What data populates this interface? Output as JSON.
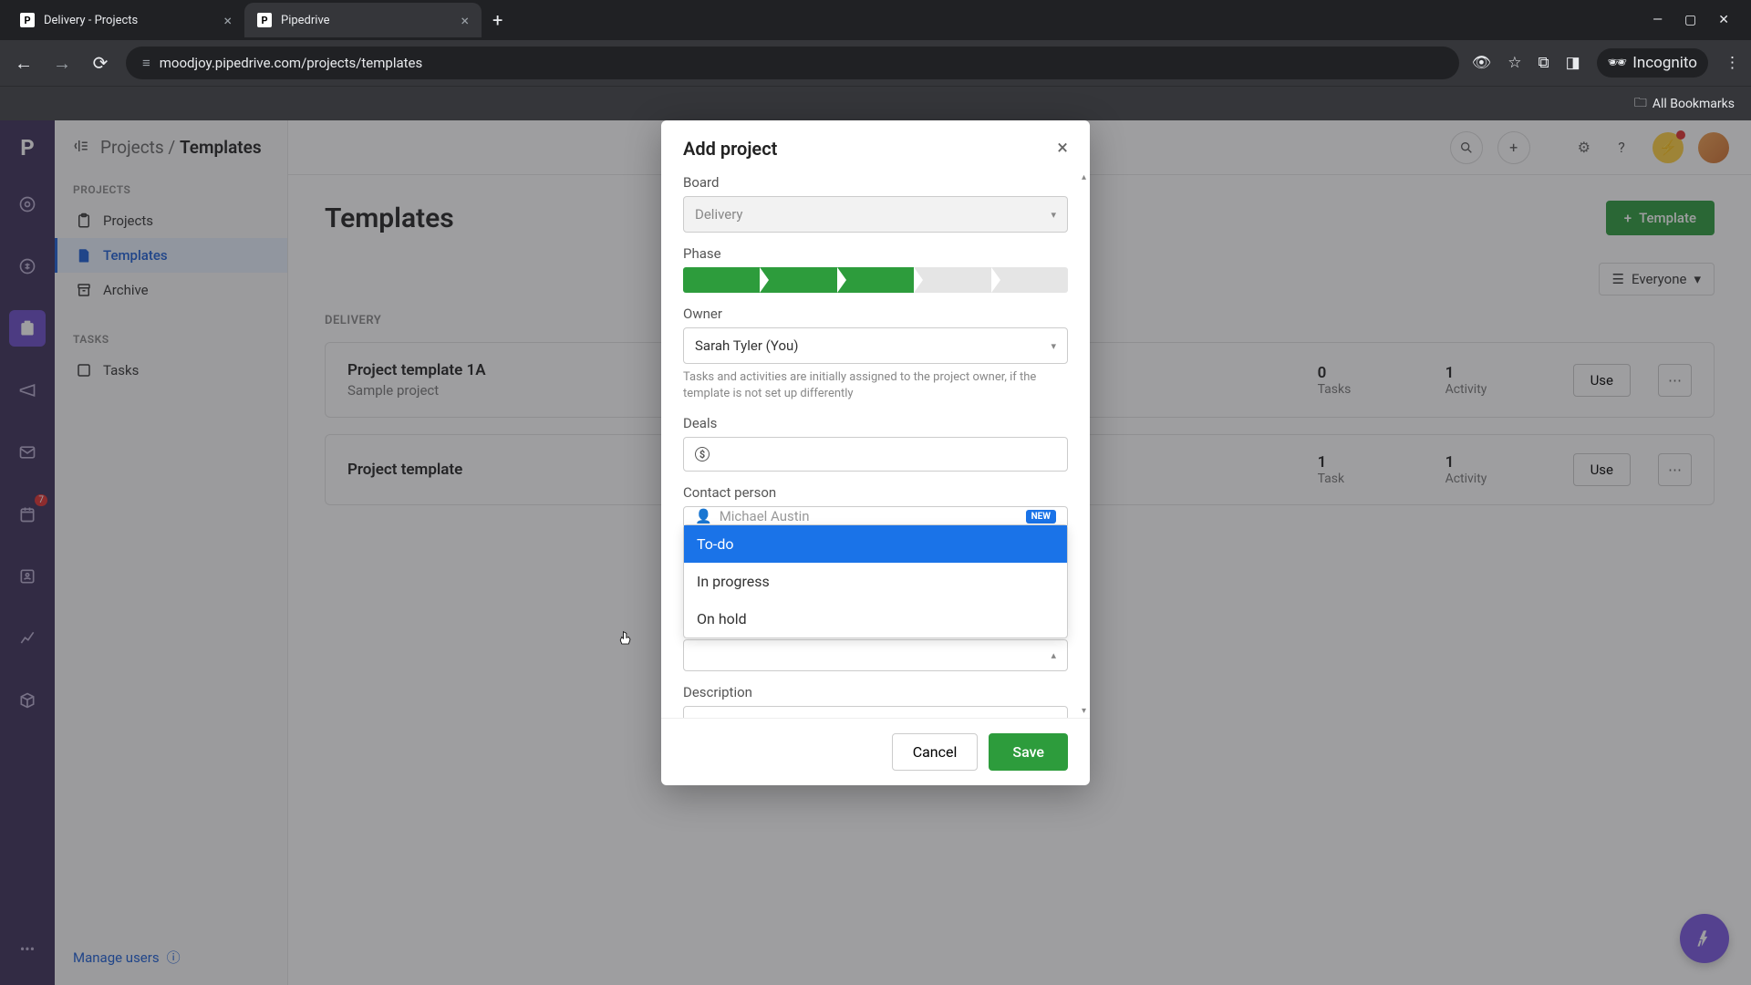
{
  "browser": {
    "tabs": [
      {
        "title": "Delivery - Projects"
      },
      {
        "title": "Pipedrive"
      }
    ],
    "url": "moodjoy.pipedrive.com/projects/templates",
    "incognito_label": "Incognito",
    "all_bookmarks": "All Bookmarks"
  },
  "breadcrumb": {
    "root": "Projects",
    "current": "Templates"
  },
  "sidebar": {
    "section_projects": "PROJECTS",
    "items_projects": [
      "Projects",
      "Templates",
      "Archive"
    ],
    "section_tasks": "TASKS",
    "items_tasks": [
      "Tasks"
    ],
    "manage_users": "Manage users"
  },
  "rail_badge": "7",
  "main": {
    "title": "Templates",
    "template_btn": "Template",
    "filter_label": "Everyone",
    "section": "DELIVERY",
    "cards": [
      {
        "title": "Project template 1A",
        "sub": "Sample project",
        "stat1_num": "0",
        "stat1_label": "Tasks",
        "stat2_num": "1",
        "stat2_label": "Activity",
        "use": "Use"
      },
      {
        "title": "Project template",
        "sub": "",
        "stat1_num": "1",
        "stat1_label": "Task",
        "stat2_num": "1",
        "stat2_label": "Activity",
        "use": "Use"
      }
    ]
  },
  "modal": {
    "title": "Add project",
    "board_label": "Board",
    "board_value": "Delivery",
    "phase_label": "Phase",
    "owner_label": "Owner",
    "owner_value": "Sarah Tyler (You)",
    "owner_help": "Tasks and activities are initially assigned to the project owner, if the template is not set up differently",
    "deals_label": "Deals",
    "contact_label": "Contact person",
    "contact_value": "Michael Austin",
    "contact_new": "NEW",
    "status_options": [
      "To-do",
      "In progress",
      "On hold"
    ],
    "description_label": "Description",
    "cancel": "Cancel",
    "save": "Save"
  }
}
